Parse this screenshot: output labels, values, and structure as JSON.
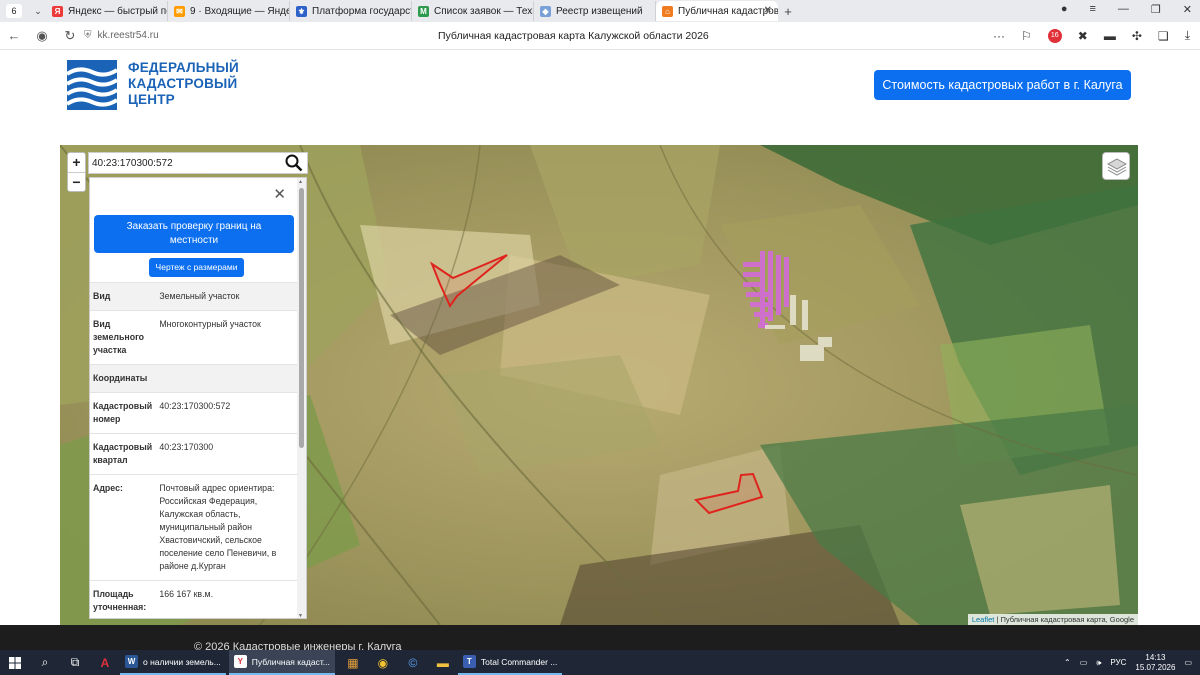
{
  "browser": {
    "tab_count": "6",
    "tabs": [
      {
        "title": "Яндекс — быстрый поиск",
        "color": "#ef3a3a"
      },
      {
        "title": "9 · Входящие — Яндекс Почта",
        "color": "#ff9d00"
      },
      {
        "title": "Платформа государственных",
        "color": "#2f62c9"
      },
      {
        "title": "Список заявок — ТехноКад",
        "color": "#2d9a4d"
      },
      {
        "title": "Реестр извещений",
        "color": "#7aa0d8"
      },
      {
        "title": "Публичная кадастровая",
        "color": "#f07c22"
      }
    ],
    "url": "kk.reestr54.ru",
    "page_title": "Публичная кадастровая карта Калужской области 2026",
    "ext_badge": "16"
  },
  "site": {
    "logo_line1": "ФЕДЕРАЛЬНЫЙ",
    "logo_line2": "КАДАСТРОВЫЙ",
    "logo_line3": "ЦЕНТР",
    "cost_button": "Стоимость кадастровых работ в г. Калуга",
    "footer": "© 2026 Кадастровые инженеры г. Калуга"
  },
  "map": {
    "zoom_in": "+",
    "zoom_out": "−",
    "search_value": "40:23:170300:572",
    "attribution_link": "Leaflet",
    "attribution_text": " | Публичная кадастровая карта, Google"
  },
  "panel": {
    "order_button": "Заказать проверку границ на местности",
    "drawing_button": "Чертеж с размерами",
    "rows": [
      {
        "key": "Вид",
        "value": "Земельный участок"
      },
      {
        "key": "Вид земельного участка",
        "value": "Многоконтурный участок"
      },
      {
        "key": "Координаты",
        "value": ""
      },
      {
        "key": "Кадастровый номер",
        "value": "40:23:170300:572"
      },
      {
        "key": "Кадастровый квартал",
        "value": "40:23:170300"
      },
      {
        "key": "Адрес:",
        "value": "Почтовый адрес ориентира: Российская Федерация, Калужская область, муниципальный район Хвастовичский, сельское поселение село Пеневичи, в районе д.Курган"
      },
      {
        "key": "Площадь уточненная:",
        "value": "166 167 кв.м."
      }
    ]
  },
  "taskbar": {
    "apps": [
      {
        "title": "о наличии земель...",
        "icon": "W",
        "color": "#2b5797"
      },
      {
        "title": "Публичная кадаст...",
        "icon": "Y",
        "color": "#e0313b"
      },
      {
        "title": "Total Commander ...",
        "icon": "T",
        "color": "#3b5fb0"
      }
    ],
    "language": "РУС",
    "time": "14:13",
    "date": "15.07.2026"
  }
}
